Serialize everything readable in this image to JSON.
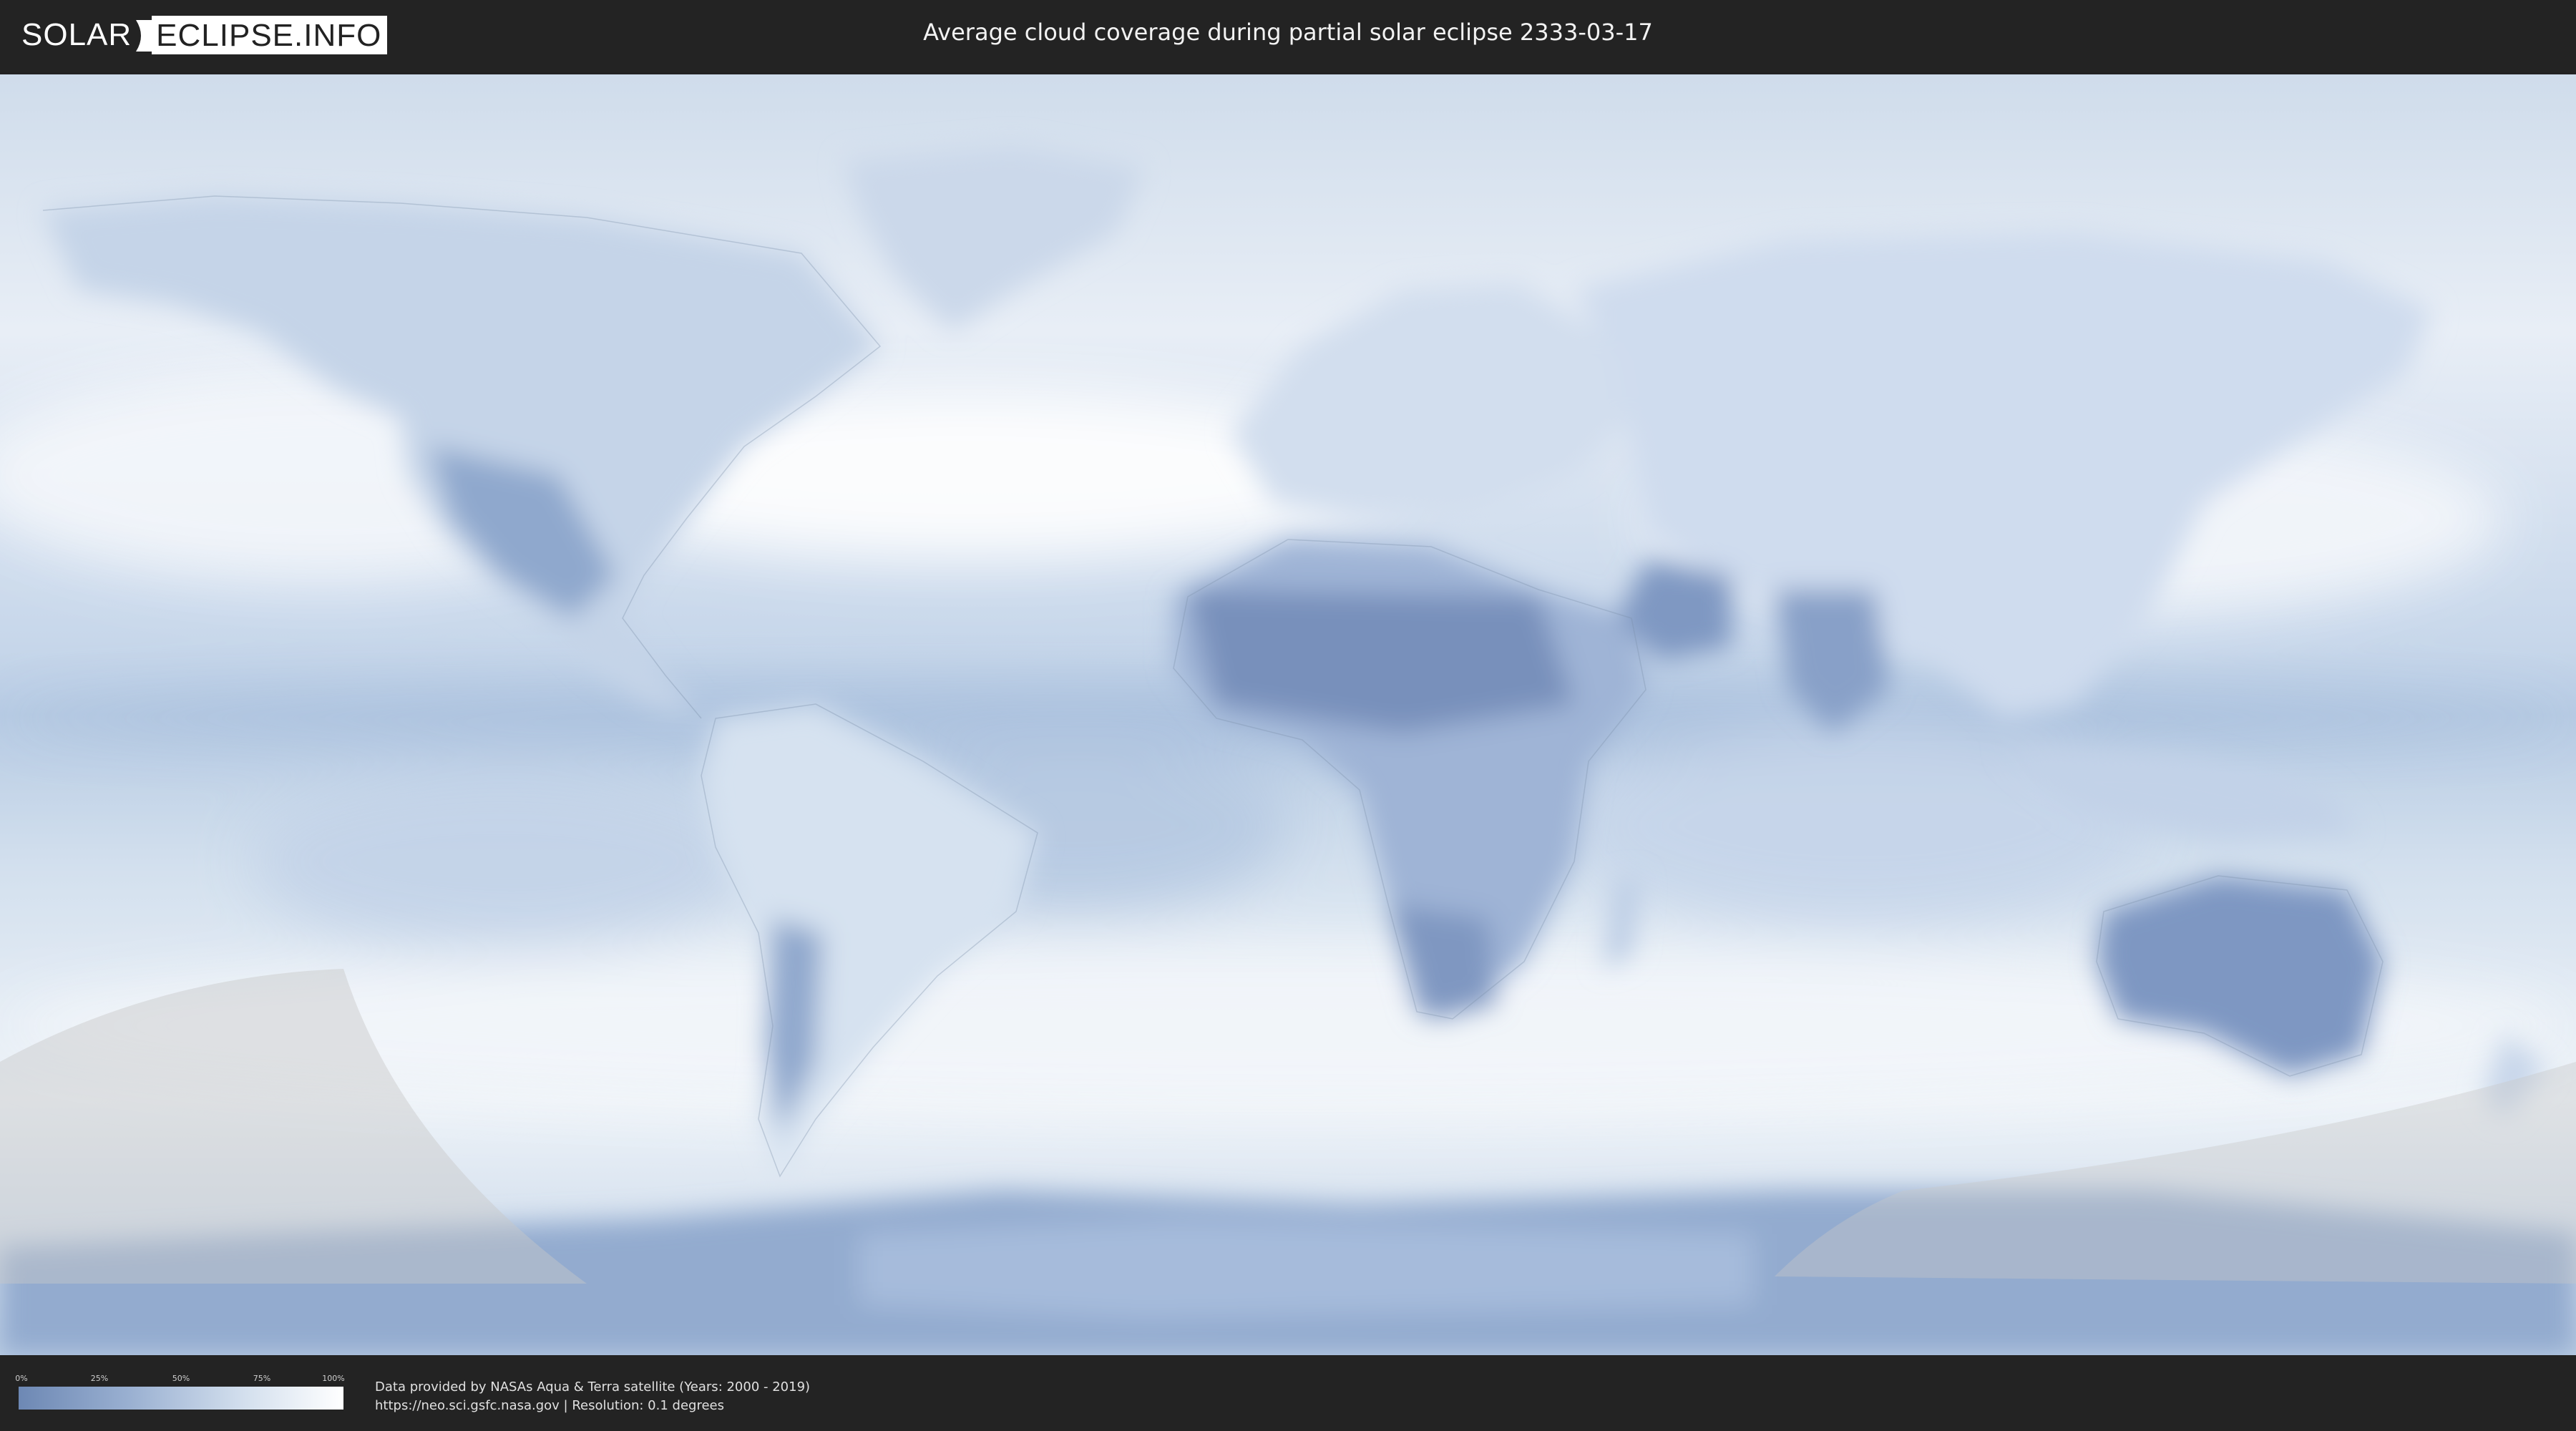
{
  "header": {
    "logo_left": "SOLAR",
    "logo_right": "ECLIPSE.INFO",
    "title": "Average cloud coverage during partial solar eclipse 2333-03-17"
  },
  "legend": {
    "ticks": [
      "0%",
      "25%",
      "50%",
      "75%",
      "100%"
    ],
    "colors": {
      "low": "#6d88b4",
      "mid": "#9bb1d2",
      "high": "#ffffff"
    }
  },
  "footer": {
    "credit_line1": "Data provided by NASAs Aqua & Terra satellite (Years: 2000 - 2019)",
    "credit_line2": "https://neo.sci.gsfc.nasa.gov | Resolution: 0.1 degrees"
  },
  "map": {
    "projection": "equirectangular",
    "ocean_color": "#dfe9f4",
    "land_clear_color": "#8ea6cc",
    "eclipse_overlay_color": "#c8c8c8"
  }
}
